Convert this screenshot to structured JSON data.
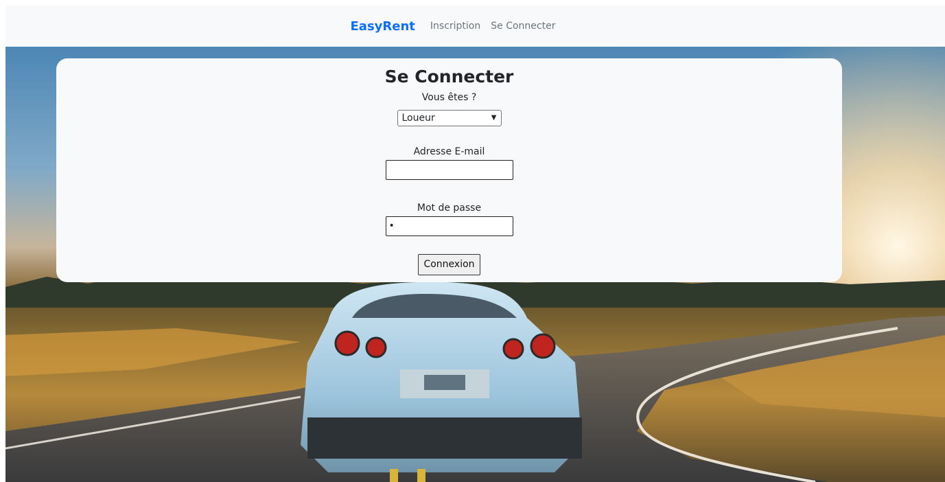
{
  "navbar": {
    "brand": "EasyRent",
    "links": [
      "Inscription",
      "Se Connecter"
    ],
    "brand_color": "#0d6efd"
  },
  "login": {
    "title": "Se Connecter",
    "type_label": "Vous êtes ?",
    "type_selected": "Loueur",
    "email_label": "Adresse E-mail",
    "email_value": "",
    "password_label": "Mot de passe",
    "password_value": "•",
    "submit_label": "Connexion"
  },
  "icons": {
    "select_chevron": "chevron-down-icon"
  }
}
